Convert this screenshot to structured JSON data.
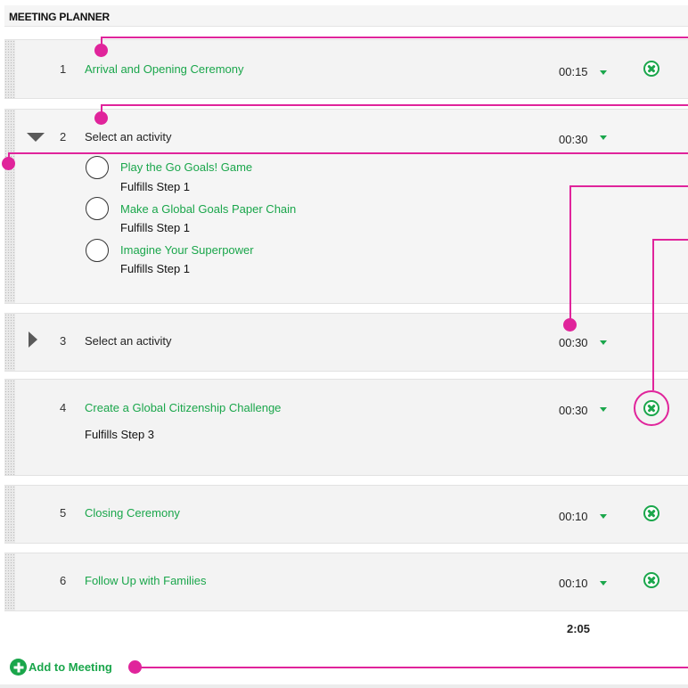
{
  "header": {
    "title": "MEETING PLANNER"
  },
  "activities": [
    {
      "number": "1",
      "title": "Arrival and Opening Ceremony",
      "time": "00:15"
    },
    {
      "number": "2",
      "title": "Select an activity",
      "time": "00:30",
      "options": [
        {
          "title": "Play the Go Goals! Game",
          "subtitle": "Fulfills Step 1"
        },
        {
          "title": "Make a Global Goals Paper Chain",
          "subtitle": "Fulfills Step 1"
        },
        {
          "title": "Imagine Your Superpower",
          "subtitle": "Fulfills Step 1"
        }
      ]
    },
    {
      "number": "3",
      "title": "Select an activity",
      "time": "00:30"
    },
    {
      "number": "4",
      "title": "Create a Global Citizenship Challenge",
      "subtitle": "Fulfills Step 3",
      "time": "00:30"
    },
    {
      "number": "5",
      "title": "Closing Ceremony",
      "time": "00:10"
    },
    {
      "number": "6",
      "title": "Follow Up with Families",
      "time": "00:10"
    }
  ],
  "total_time": "2:05",
  "add_button": {
    "label": "Add to Meeting"
  },
  "colors": {
    "accent_green": "#1aa64b",
    "annotation_magenta": "#e0249b",
    "row_background": "#f3f3f3"
  },
  "icons": {
    "remove": "remove-circle-x-icon",
    "time_dropdown": "caret-down-icon",
    "expanded": "triangle-down-icon",
    "collapsed": "triangle-right-icon",
    "add": "plus-circle-icon"
  }
}
